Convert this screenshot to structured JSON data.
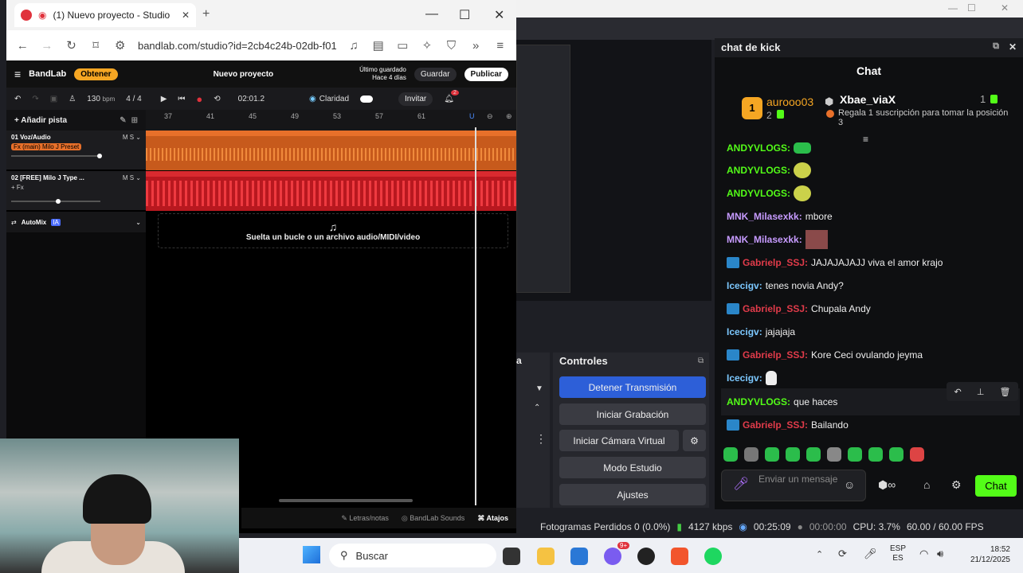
{
  "browser": {
    "tab_title": "(1) Nuevo proyecto - Studio",
    "url": "bandlab.com/studio?id=2cb4c24b-02db-f011"
  },
  "bandlab": {
    "brand": "BandLab",
    "obtener": "Obtener",
    "project_title": "Nuevo proyecto",
    "saved_line1": "Último guardado",
    "saved_line2": "Hace 4 días",
    "save": "Guardar",
    "publish": "Publicar",
    "bpm": "130",
    "bpm_unit": "bpm",
    "time_sig": "4 / 4",
    "time": "02:01.2",
    "clarity": "Claridad",
    "invite": "Invitar",
    "notif_count": "2",
    "add_track": "Añadir pista",
    "ruler_ticks": [
      "37",
      "41",
      "45",
      "49",
      "53",
      "57",
      "61"
    ],
    "track1_name": "01  Voz/Audio",
    "track1_fx": "Fx (main) Milo J Preset",
    "track2_name": "02  [FREE] Milo J Type ...",
    "track2_fx": "+ Fx",
    "automix": "AutoMix",
    "ia": "IA",
    "drop_text": "Suelta un bucle o un archivo audio/MIDI/video",
    "footer_lyrics": "Letras/notas",
    "footer_sounds": "BandLab Sounds",
    "footer_shortcuts": "Atajos",
    "ms_m": "M",
    "ms_s": "S"
  },
  "obs": {
    "controls_title": "Controles",
    "stop_stream": "Detener Transmisión",
    "start_record": "Iniciar Grabación",
    "virtual_cam": "Iniciar Cámara Virtual",
    "studio_mode": "Modo Estudio",
    "settings": "Ajustes",
    "scenes_title": "a",
    "status": {
      "frames_lost": "Fotogramas Perdidos 0 (0.0%)",
      "kbps": "4127 kbps",
      "stream_time": "00:25:09",
      "rec_time": "00:00:00",
      "cpu": "CPU: 3.7%",
      "fps": "60.00 / 60.00 FPS"
    }
  },
  "chat": {
    "window_title": "chat de kick",
    "header": "Chat",
    "leader_rank": "1",
    "leader_name": "aurooo03",
    "leader_count": "2",
    "leader2_name": "Xbae_viaX",
    "leader2_count": "1",
    "leader2_hint": "Regala 1 suscripción para tomar la posición 3",
    "messages": [
      {
        "user": "ANDYVLOGS:",
        "text": ""
      },
      {
        "user": "ANDYVLOGS:",
        "text": ""
      },
      {
        "user": "ANDYVLOGS:",
        "text": ""
      },
      {
        "user": "MNK_Milasexkk:",
        "text": "mbore"
      },
      {
        "user": "MNK_Milasexkk:",
        "text": ""
      },
      {
        "user": "Gabrielp_SSJ:",
        "text": "JAJAJAJAJJ viva el amor krajo"
      },
      {
        "user": "Icecigv:",
        "text": "tenes novia Andy?"
      },
      {
        "user": "Gabrielp_SSJ:",
        "text": "Chupala Andy"
      },
      {
        "user": "Icecigv:",
        "text": "jajajaja"
      },
      {
        "user": "Gabrielp_SSJ:",
        "text": "Kore Ceci ovulando jeyma"
      },
      {
        "user": "Icecigv:",
        "text": ""
      },
      {
        "user": "ANDYVLOGS:",
        "text": "que haces"
      },
      {
        "user": "Gabrielp_SSJ:",
        "text": "Bailando"
      }
    ],
    "input_placeholder": "Enviar un mensaje",
    "send": "Chat"
  },
  "taskbar": {
    "search": "Buscar",
    "lang1": "ESP",
    "lang2": "ES",
    "time": "18:52",
    "date": "21/12/2025",
    "badge": "9+"
  }
}
